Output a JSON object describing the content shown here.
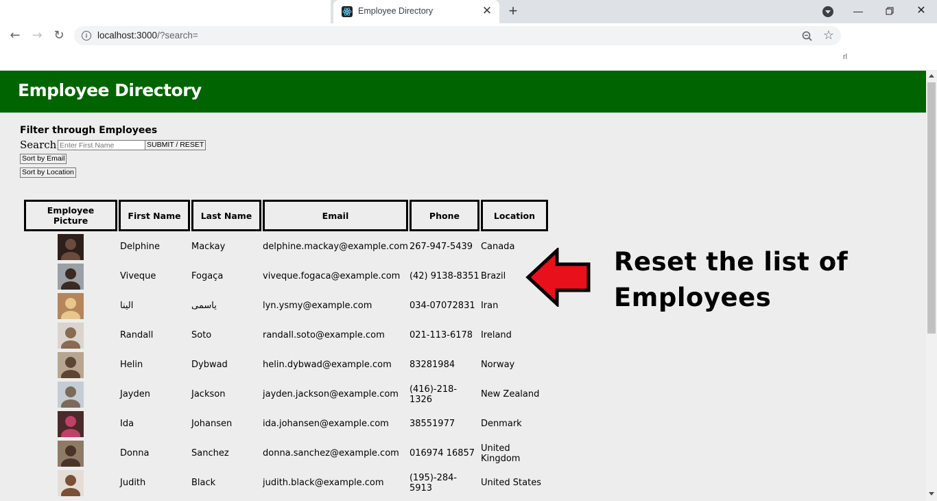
{
  "browser": {
    "tab_title": "Employee Directory",
    "url_host": "localhost:3000",
    "url_path": "/?search=",
    "bookmark_fragment": "rl"
  },
  "app": {
    "title": "Employee Directory",
    "filter_heading": "Filter through Employees",
    "search_label": "Search:",
    "search_placeholder": "Enter First Name",
    "search_value": "",
    "submit_label": "SUBMIT / RESET",
    "sort_email_label": "Sort by Email",
    "sort_location_label": "Sort by Location",
    "brand_color": "#006400"
  },
  "table": {
    "headers": [
      "Employee Picture",
      "First Name",
      "Last Name",
      "Email",
      "Phone",
      "Location"
    ],
    "rows": [
      {
        "first": "Delphine",
        "last": "Mackay",
        "email": "delphine.mackay@example.com",
        "phone": "267-947-5439",
        "location": "Canada"
      },
      {
        "first": "Viveque",
        "last": "Fogaça",
        "email": "viveque.fogaca@example.com",
        "phone": "(42) 9138-8351",
        "location": "Brazil"
      },
      {
        "first": "الینا",
        "last": "یاسمی",
        "email": "lyn.ysmy@example.com",
        "phone": "034-07072831",
        "location": "Iran"
      },
      {
        "first": "Randall",
        "last": "Soto",
        "email": "randall.soto@example.com",
        "phone": "021-113-6178",
        "location": "Ireland"
      },
      {
        "first": "Helin",
        "last": "Dybwad",
        "email": "helin.dybwad@example.com",
        "phone": "83281984",
        "location": "Norway"
      },
      {
        "first": "Jayden",
        "last": "Jackson",
        "email": "jayden.jackson@example.com",
        "phone": "(416)-218-1326",
        "location": "New Zealand"
      },
      {
        "first": "Ida",
        "last": "Johansen",
        "email": "ida.johansen@example.com",
        "phone": "38551977",
        "location": "Denmark"
      },
      {
        "first": "Donna",
        "last": "Sanchez",
        "email": "donna.sanchez@example.com",
        "phone": "016974 16857",
        "location": "United Kingdom"
      },
      {
        "first": "Judith",
        "last": "Black",
        "email": "judith.black@example.com",
        "phone": "(195)-284-5913",
        "location": "United States"
      }
    ]
  },
  "annotation": {
    "line1": "Reset the list of",
    "line2": "Employees",
    "arrow_color": "#e8101a"
  }
}
